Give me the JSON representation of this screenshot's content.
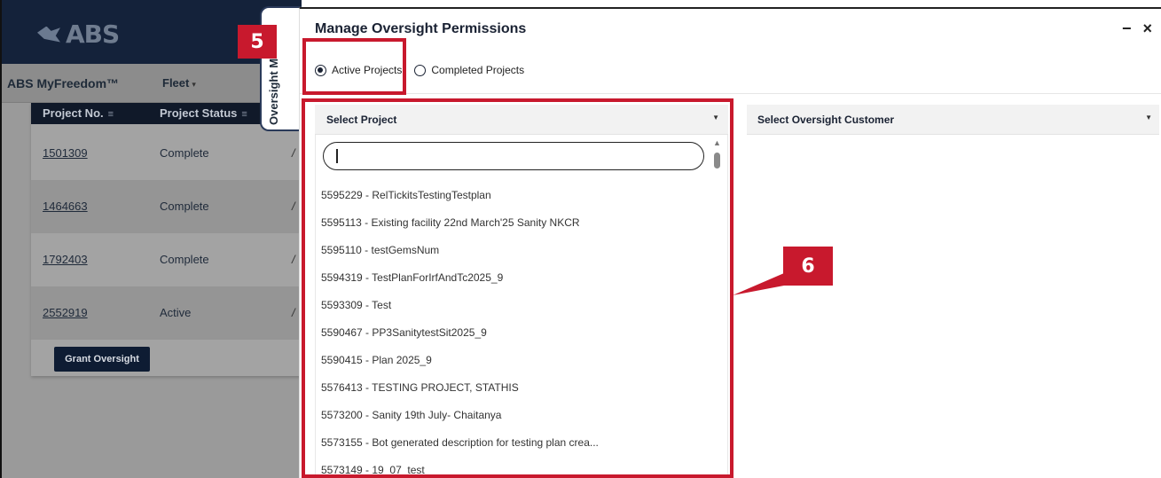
{
  "background_app": {
    "logo_text": "ABS",
    "brand": "ABS MyFreedom™",
    "nav_fleet": "Fleet",
    "table": {
      "col_project_no": "Project No.",
      "col_project_status": "Project Status",
      "rows": [
        {
          "project_no": "1501309",
          "status": "Complete"
        },
        {
          "project_no": "1464663",
          "status": "Complete"
        },
        {
          "project_no": "1792403",
          "status": "Complete"
        },
        {
          "project_no": "2552919",
          "status": "Active"
        }
      ]
    },
    "grant_button": "Grant Oversight",
    "side_tab_label": "Oversight M"
  },
  "modal": {
    "title": "Manage Oversight Permissions",
    "window_controls": "− ×",
    "radio_active": "Active Projects",
    "radio_completed": "Completed Projects",
    "select_project_placeholder": "Select Project",
    "select_customer_placeholder": "Select Oversight Customer",
    "project_options": [
      "5595229 - RelTickitsTestingTestplan",
      "5595113 - Existing facility 22nd March'25 Sanity NKCR",
      "5595110 - testGemsNum",
      "5594319 - TestPlanForIrfAndTc2025_9",
      "5593309 - Test",
      "5590467 - PP3SanitytestSit2025_9",
      "5590415 - Plan 2025_9",
      "5576413 - TESTING PROJECT, STATHIS",
      "5573200 - Sanity 19th July- Chaitanya",
      "5573155 - Bot generated description for testing plan crea...",
      "5573149 - 19_07_test"
    ]
  },
  "annotations": {
    "callout_5": "5",
    "callout_6": "6",
    "color": "#c8192d"
  },
  "colors": {
    "navy": "#0b1d3a",
    "accent_red": "#c8192d"
  }
}
